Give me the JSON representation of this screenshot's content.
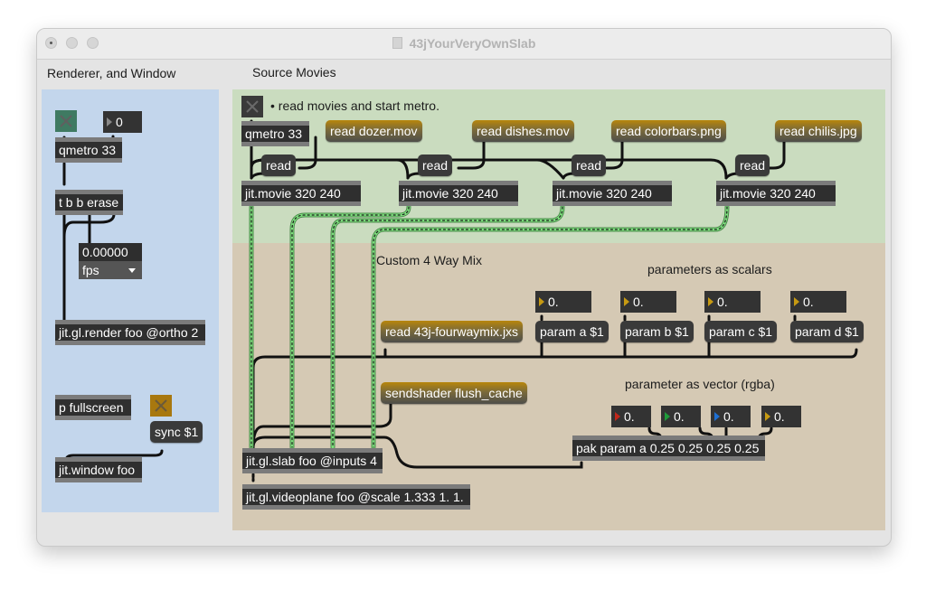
{
  "window": {
    "title": "43jYourVeryOwnSlab",
    "traffic_lights": [
      "close-button",
      "minimize-button",
      "zoom-button"
    ]
  },
  "sections": {
    "left_title": "Renderer, and Window",
    "right_title": "Source Movies"
  },
  "colors": {
    "left_panel_bg": "#c3d6ec",
    "source_panel_bg": "#cadcbf",
    "mix_panel_bg": "#d5c9b4",
    "message_gold": "#b8860b",
    "object_bg": "#2f2f2f",
    "matrix_wire": "#6fd36f",
    "red_tri": "#c0281a",
    "green_tri": "#1f9a3a",
    "blue_tri": "#1e6fd1",
    "yellow_tri": "#c79a12"
  },
  "left": {
    "metro_number": "0",
    "qmetro": "qmetro 33",
    "trigger": "t b b erase",
    "fps_value": "0.00000",
    "fps_menu": "fps",
    "render": "jit.gl.render foo @ortho 2",
    "fullscreen": "p fullscreen",
    "sync": "sync $1",
    "window": "jit.window foo"
  },
  "source": {
    "comment": "• read movies and start metro.",
    "qmetro": "qmetro 33",
    "read_messages": [
      "read dozer.mov",
      "read dishes.mov",
      "read colorbars.png",
      "read chilis.jpg"
    ],
    "read_label": "read",
    "movie": "jit.movie 320 240"
  },
  "mix": {
    "title": "Custom 4 Way Mix",
    "scalars_comment": "parameters as scalars",
    "read_shader": "read 43j-fourwaymix.jxs",
    "scalar_numbers": [
      "0.",
      "0.",
      "0.",
      "0."
    ],
    "params": [
      "param a $1",
      "param b $1",
      "param c $1",
      "param d $1"
    ],
    "vector_comment": "parameter as vector (rgba)",
    "vector_numbers": [
      "0.",
      "0.",
      "0.",
      "0."
    ],
    "sendshader": "sendshader flush_cache",
    "pak": "pak param a 0.25 0.25 0.25 0.25",
    "slab": "jit.gl.slab foo @inputs 4",
    "videoplane": "jit.gl.videoplane foo @scale 1.333 1. 1."
  }
}
